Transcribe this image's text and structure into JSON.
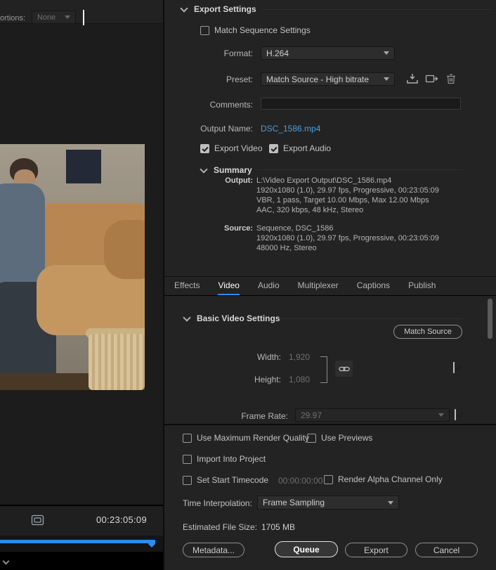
{
  "colors": {
    "accent_blue": "#2d8ceb",
    "link_blue": "#4a9edf",
    "panel_bg": "#232323"
  },
  "icons": {
    "section_chevron": "chevron-down",
    "dropdown_chevron": "chevron-down",
    "save_preset": "save",
    "import_preset": "import",
    "delete_preset": "trash",
    "link_toggle": "chain-link",
    "fit_frame": "fit-frame",
    "check": "checkmark"
  },
  "left_pane": {
    "crop_label": "ortions:",
    "crop_value": "None",
    "timecode": "00:23:05:09"
  },
  "export_settings": {
    "title": "Export Settings",
    "match_sequence_label": "Match Sequence Settings",
    "format_label": "Format:",
    "format_value": "H.264",
    "preset_label": "Preset:",
    "preset_value": "Match Source - High bitrate",
    "comments_label": "Comments:",
    "comments_value": "",
    "output_name_label": "Output Name:",
    "output_name_value": "DSC_1586.mp4",
    "export_video_label": "Export Video",
    "export_audio_label": "Export Audio"
  },
  "summary": {
    "title": "Summary",
    "output_label": "Output:",
    "output_lines": [
      "L:\\Video Export Output\\DSC_1586.mp4",
      "1920x1080 (1.0), 29.97 fps, Progressive, 00:23:05:09",
      "VBR, 1 pass, Target 10.00 Mbps, Max 12.00 Mbps",
      "AAC, 320 kbps, 48 kHz, Stereo"
    ],
    "source_label": "Source:",
    "source_lines": [
      "Sequence, DSC_1586",
      "1920x1080 (1.0), 29.97 fps, Progressive, 00:23:05:09",
      "48000 Hz, Stereo"
    ]
  },
  "tabs": [
    {
      "label": "Effects",
      "active": false
    },
    {
      "label": "Video",
      "active": true
    },
    {
      "label": "Audio",
      "active": false
    },
    {
      "label": "Multiplexer",
      "active": false
    },
    {
      "label": "Captions",
      "active": false
    },
    {
      "label": "Publish",
      "active": false
    }
  ],
  "video_settings": {
    "section_title": "Basic Video Settings",
    "match_source_button": "Match Source",
    "width_label": "Width:",
    "width_value": "1,920",
    "height_label": "Height:",
    "height_value": "1,080",
    "frame_rate_label": "Frame Rate:",
    "frame_rate_value": "29.97"
  },
  "bottom": {
    "use_max_render_label": "Use Maximum Render Quality",
    "use_previews_label": "Use Previews",
    "import_into_project_label": "Import Into Project",
    "set_start_timecode_label": "Set Start Timecode",
    "start_timecode_value": "00:00:00:00",
    "render_alpha_label": "Render Alpha Channel Only",
    "time_interpolation_label": "Time Interpolation:",
    "time_interpolation_value": "Frame Sampling",
    "estimated_size_label": "Estimated File Size:",
    "estimated_size_value": "1705 MB",
    "metadata_button": "Metadata...",
    "queue_button": "Queue",
    "export_button": "Export",
    "cancel_button": "Cancel"
  }
}
